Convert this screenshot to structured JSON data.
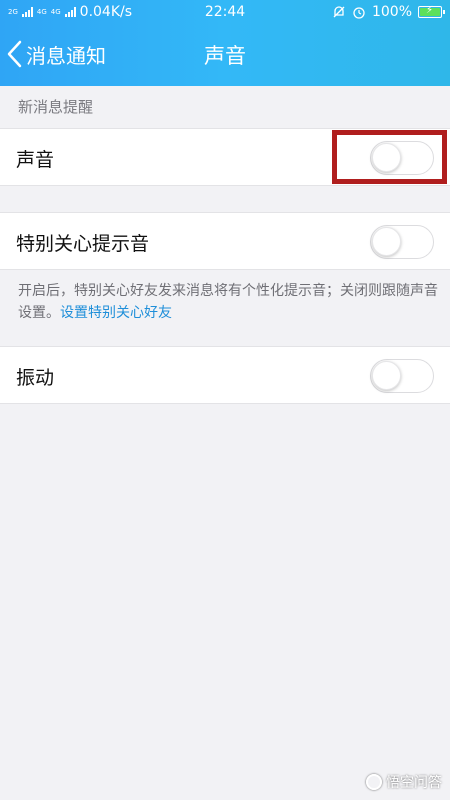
{
  "status_bar": {
    "network_top": "2G",
    "network_4g": "4G",
    "network_4g_2": "4G",
    "speed": "0.04K/s",
    "time": "22:44",
    "battery": "100%"
  },
  "nav": {
    "back_label": "消息通知",
    "title": "声音"
  },
  "section": {
    "header": "新消息提醒"
  },
  "rows": {
    "sound": {
      "label": "声音",
      "enabled": false
    },
    "special_care": {
      "label": "特别关心提示音",
      "enabled": false
    },
    "vibrate": {
      "label": "振动",
      "enabled": false
    }
  },
  "description": {
    "text": "开启后，特别关心好友发来消息将有个性化提示音；关闭则跟随声音设置。",
    "link": "设置特别关心好友"
  },
  "watermark": {
    "text": "悟空问答"
  },
  "colors": {
    "header_start": "#2fa5f5",
    "header_end": "#2fb7e9",
    "highlight": "#b01e1e",
    "link": "#1f8fd9",
    "battery": "#5ce05c"
  },
  "icons": {
    "back": "chevron-left-icon",
    "alarm": "alarm-clock-icon",
    "mute": "bell-off-icon",
    "battery": "battery-charging-icon"
  }
}
